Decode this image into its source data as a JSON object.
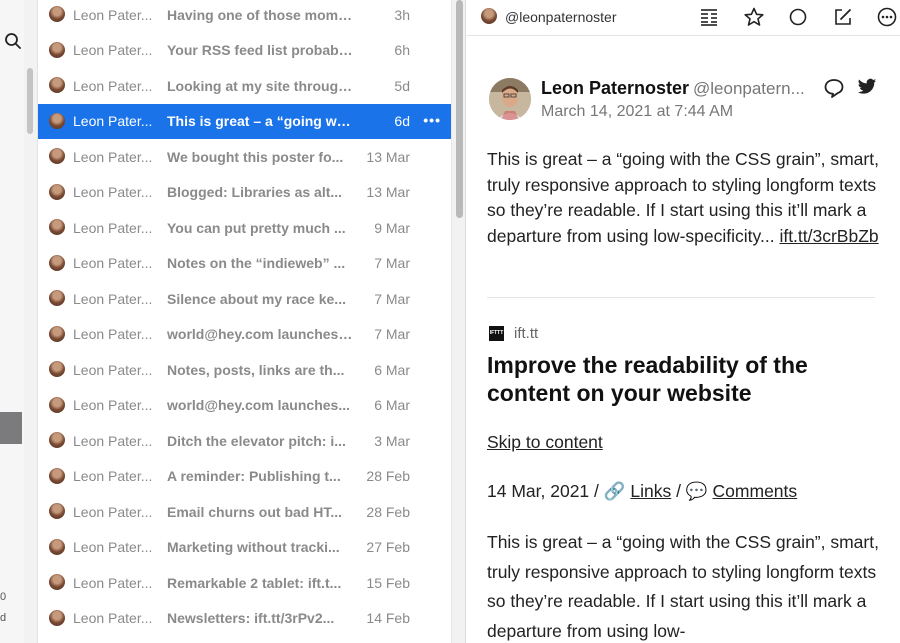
{
  "sidebar": {
    "search_icon": "search-icon",
    "fragments": [
      "0",
      "d"
    ]
  },
  "timeline": {
    "items": [
      {
        "author": "Leon Pater...",
        "title": "Having one of those moment...",
        "date": "3h"
      },
      {
        "author": "Leon Pater...",
        "title": "Your RSS feed list probably ...",
        "date": "6h"
      },
      {
        "author": "Leon Pater...",
        "title": "Looking at my site through ti...",
        "date": "5d"
      },
      {
        "author": "Leon Pater...",
        "title": "This is great – a “going with ...",
        "date": "6d",
        "selected": true,
        "more": "•••"
      },
      {
        "author": "Leon Pater...",
        "title": "We bought this poster fo...",
        "date": "13 Mar"
      },
      {
        "author": "Leon Pater...",
        "title": "Blogged: Libraries as alt...",
        "date": "13 Mar"
      },
      {
        "author": "Leon Pater...",
        "title": "You can put pretty much ...",
        "date": "9 Mar"
      },
      {
        "author": "Leon Pater...",
        "title": "Notes on the “indieweb” ...",
        "date": "7 Mar"
      },
      {
        "author": "Leon Pater...",
        "title": "Silence about my race ke...",
        "date": "7 Mar"
      },
      {
        "author": "Leon Pater...",
        "title": "world@hey.com launches ...",
        "date": "7 Mar"
      },
      {
        "author": "Leon Pater...",
        "title": "Notes, posts, links are th...",
        "date": "6 Mar"
      },
      {
        "author": "Leon Pater...",
        "title": "world@hey.com launches...",
        "date": "6 Mar"
      },
      {
        "author": "Leon Pater...",
        "title": "Ditch the elevator pitch: i...",
        "date": "3 Mar"
      },
      {
        "author": "Leon Pater...",
        "title": "A reminder: Publishing t...",
        "date": "28 Feb"
      },
      {
        "author": "Leon Pater...",
        "title": "Email churns out bad HT...",
        "date": "28 Feb"
      },
      {
        "author": "Leon Pater...",
        "title": "Marketing without tracki...",
        "date": "27 Feb"
      },
      {
        "author": "Leon Pater...",
        "title": "Remarkable 2 tablet: ift.t...",
        "date": "15 Feb"
      },
      {
        "author": "Leon Pater...",
        "title": "Newsletters: ift.tt/3rPv2...",
        "date": "14 Feb"
      }
    ]
  },
  "toolbar": {
    "handle": "@leonpaternoster",
    "icons": [
      "reader-view-icon",
      "star-icon",
      "circle-icon",
      "compose-icon",
      "more-icon"
    ]
  },
  "post": {
    "author_name": "Leon Paternoster",
    "author_handle": "@leonpatern...",
    "date": "March 14, 2021 at 7:44 AM",
    "body": "This is great – a “going with the CSS grain”, smart, truly responsive approach to styling longform texts so they’re readable. If I start using this it’ll mark a departure from using low-specificity... ",
    "link": "ift.tt/3crBbZb",
    "source_name": "ift.tt",
    "source_icon_text": "IFTTT",
    "article_title": "Improve the readability of the content on your website",
    "skip_link": "Skip to content",
    "meta_date": "14 Mar, 2021 / ",
    "meta_link_icon": "🔗",
    "meta_links": "Links",
    "meta_sep": " / ",
    "meta_comment_icon": "💬",
    "meta_comments": "Comments",
    "body2": "This is great – a “going with the CSS grain”, smart, truly responsive approach to styling longform texts so they’re readable. If I start using this it’ll mark a departure from using low-"
  }
}
